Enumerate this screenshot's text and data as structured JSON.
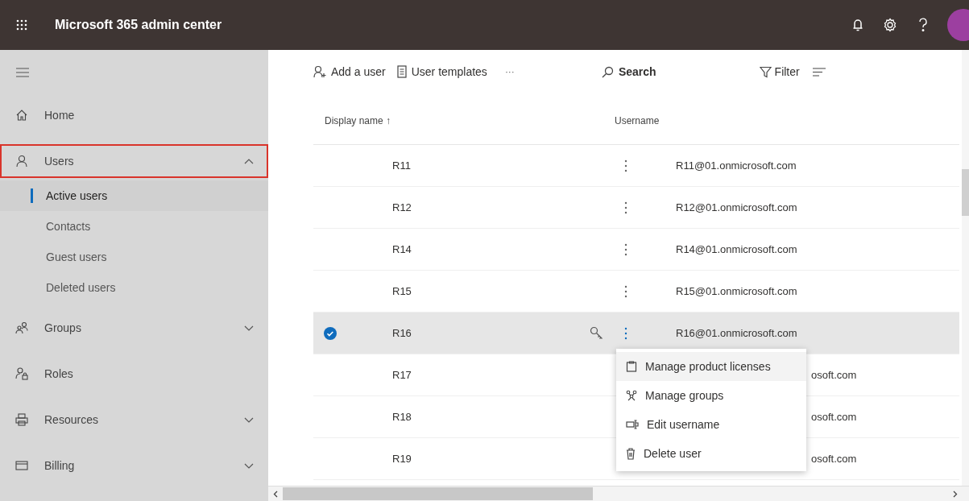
{
  "header": {
    "title": "Microsoft 365 admin center"
  },
  "sidebar": {
    "items": [
      {
        "label": "Home",
        "highlighted": false
      },
      {
        "label": "Users",
        "expanded": true,
        "highlighted": true,
        "children": [
          {
            "label": "Active users",
            "selected": true
          },
          {
            "label": "Contacts",
            "selected": false
          },
          {
            "label": "Guest users",
            "selected": false
          },
          {
            "label": "Deleted users",
            "selected": false
          }
        ]
      },
      {
        "label": "Groups",
        "expanded": false,
        "highlighted": false
      },
      {
        "label": "Roles",
        "highlighted": false
      },
      {
        "label": "Resources",
        "expanded": false,
        "highlighted": false
      },
      {
        "label": "Billing",
        "expanded": false,
        "highlighted": false
      }
    ]
  },
  "toolbar": {
    "add_user": "Add a user",
    "user_templates": "User templates",
    "more": "···",
    "search": "Search",
    "filter": "Filter"
  },
  "table": {
    "columns": [
      "Display name ↑",
      "Username"
    ],
    "rows": [
      {
        "name": "R11",
        "username": "R11@01.onmicrosoft.com",
        "selected": false
      },
      {
        "name": "R12",
        "username": "R12@01.onmicrosoft.com",
        "selected": false
      },
      {
        "name": "R14",
        "username": "R14@01.onmicrosoft.com",
        "selected": false
      },
      {
        "name": "R15",
        "username": "R15@01.onmicrosoft.com",
        "selected": false
      },
      {
        "name": "R16",
        "username": "R16@01.onmicrosoft.com",
        "selected": true
      },
      {
        "name": "R17",
        "username": "osoft.com",
        "selected": false,
        "covered": true
      },
      {
        "name": "R18",
        "username": "osoft.com",
        "selected": false,
        "covered": true
      },
      {
        "name": "R19",
        "username": "osoft.com",
        "selected": false,
        "covered": true
      }
    ]
  },
  "context_menu": {
    "items": [
      {
        "label": "Manage product licenses",
        "kind": "licenses",
        "selected": true
      },
      {
        "label": "Manage groups",
        "kind": "groups",
        "selected": false
      },
      {
        "label": "Edit username",
        "kind": "edit",
        "selected": false
      },
      {
        "label": "Delete user",
        "kind": "delete",
        "selected": false
      }
    ]
  }
}
